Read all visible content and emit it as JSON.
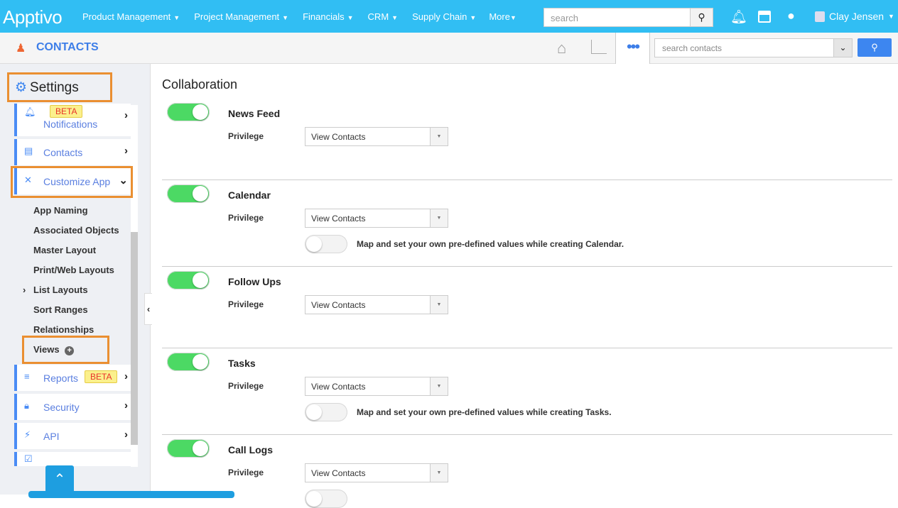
{
  "topbar": {
    "logo": "Apptivo",
    "nav": [
      "Product Management",
      "Project Management",
      "Financials",
      "CRM",
      "Supply Chain",
      "More"
    ],
    "search_placeholder": "search",
    "user": "Clay Jensen",
    "icons": [
      "bell-icon",
      "store-icon",
      "connections-icon"
    ],
    "color": "#31bef3"
  },
  "subheader": {
    "title": "CONTACTS",
    "search_placeholder": "search contacts",
    "icons": [
      "home-icon",
      "chart-icon",
      "more-icon"
    ]
  },
  "sidebar": {
    "title": "Settings",
    "menu": [
      {
        "label": "Notifications",
        "badge": "BETA"
      },
      {
        "label": "Contacts"
      },
      {
        "label": "Customize App"
      },
      {
        "label": "Reports",
        "badge": "BETA"
      },
      {
        "label": "Security"
      },
      {
        "label": "API"
      }
    ],
    "subitems": [
      "App Naming",
      "Associated Objects",
      "Master Layout",
      "Print/Web Layouts",
      "List Layouts",
      "Sort Ranges",
      "Relationships",
      "Views"
    ]
  },
  "main": {
    "title": "Collaboration",
    "privilege_label": "Privilege",
    "sections": [
      {
        "name": "News Feed",
        "enabled": true,
        "privilege": "View Contacts"
      },
      {
        "name": "Calendar",
        "enabled": true,
        "privilege": "View Contacts",
        "map_text": "Map and set your own pre-defined values while creating Calendar.",
        "map_enabled": false
      },
      {
        "name": "Follow Ups",
        "enabled": true,
        "privilege": "View Contacts"
      },
      {
        "name": "Tasks",
        "enabled": true,
        "privilege": "View Contacts",
        "map_text": "Map and set your own pre-defined values while creating Tasks.",
        "map_enabled": false
      },
      {
        "name": "Call Logs",
        "enabled": true,
        "privilege": "View Contacts"
      }
    ]
  }
}
